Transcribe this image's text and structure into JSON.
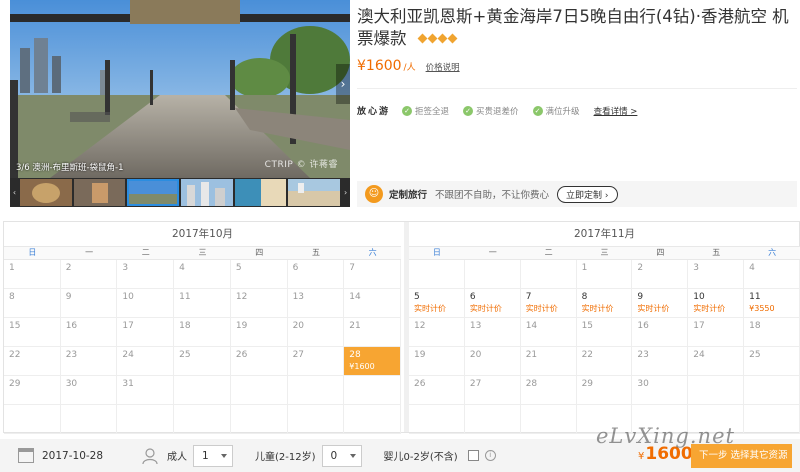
{
  "gallery": {
    "caption": "3/6 澳洲-布里斯班-袋鼠角-1",
    "photo_watermark": "CTRIP © 许蒋睿",
    "next_arrow": "›",
    "thumb_prev": "‹",
    "thumb_next": "›",
    "active_thumb": 3
  },
  "product": {
    "title": "澳大利亚凯恩斯+黄金海岸7日5晚自由行(4钻)·香港航空 机票爆款",
    "diamond_count": 4,
    "price": "¥1600",
    "per_person": "/人",
    "price_link": "价格说明"
  },
  "assurance": {
    "title": "放心游",
    "items": [
      "拒签全退",
      "买贵退差价",
      "满位升级"
    ],
    "more": "查看详情 >"
  },
  "custom": {
    "icon": "☺",
    "title": "定制旅行",
    "text": "不跟团不自助，不让你费心",
    "button": "立即定制 ›"
  },
  "calendar": {
    "weekdays": [
      "日",
      "一",
      "二",
      "三",
      "四",
      "五",
      "六"
    ],
    "months": [
      {
        "title": "2017年10月",
        "weeks": [
          [
            {
              "d": "1"
            },
            {
              "d": "2"
            },
            {
              "d": "3"
            },
            {
              "d": "4"
            },
            {
              "d": "5"
            },
            {
              "d": "6"
            },
            {
              "d": "7"
            }
          ],
          [
            {
              "d": "8"
            },
            {
              "d": "9"
            },
            {
              "d": "10"
            },
            {
              "d": "11"
            },
            {
              "d": "12"
            },
            {
              "d": "13"
            },
            {
              "d": "14"
            }
          ],
          [
            {
              "d": "15"
            },
            {
              "d": "16"
            },
            {
              "d": "17"
            },
            {
              "d": "18"
            },
            {
              "d": "19"
            },
            {
              "d": "20"
            },
            {
              "d": "21"
            }
          ],
          [
            {
              "d": "22"
            },
            {
              "d": "23"
            },
            {
              "d": "24"
            },
            {
              "d": "25"
            },
            {
              "d": "26"
            },
            {
              "d": "27"
            },
            {
              "d": "28",
              "info": "¥1600",
              "selected": true
            }
          ],
          [
            {
              "d": "29"
            },
            {
              "d": "30"
            },
            {
              "d": "31"
            },
            {
              "d": ""
            },
            {
              "d": ""
            },
            {
              "d": ""
            },
            {
              "d": ""
            }
          ],
          [
            {
              "d": ""
            },
            {
              "d": ""
            },
            {
              "d": ""
            },
            {
              "d": ""
            },
            {
              "d": ""
            },
            {
              "d": ""
            },
            {
              "d": ""
            }
          ]
        ]
      },
      {
        "title": "2017年11月",
        "weeks": [
          [
            {
              "d": ""
            },
            {
              "d": ""
            },
            {
              "d": ""
            },
            {
              "d": "1"
            },
            {
              "d": "2"
            },
            {
              "d": "3"
            },
            {
              "d": "4"
            }
          ],
          [
            {
              "d": "5",
              "info": "实时计价"
            },
            {
              "d": "6",
              "info": "实时计价"
            },
            {
              "d": "7",
              "info": "实时计价"
            },
            {
              "d": "8",
              "info": "实时计价"
            },
            {
              "d": "9",
              "info": "实时计价"
            },
            {
              "d": "10",
              "info": "实时计价"
            },
            {
              "d": "11",
              "info": "¥3550"
            }
          ],
          [
            {
              "d": "12"
            },
            {
              "d": "13"
            },
            {
              "d": "14"
            },
            {
              "d": "15"
            },
            {
              "d": "16"
            },
            {
              "d": "17"
            },
            {
              "d": "18"
            }
          ],
          [
            {
              "d": "19"
            },
            {
              "d": "20"
            },
            {
              "d": "21"
            },
            {
              "d": "22"
            },
            {
              "d": "23"
            },
            {
              "d": "24"
            },
            {
              "d": "25"
            }
          ],
          [
            {
              "d": "26"
            },
            {
              "d": "27"
            },
            {
              "d": "28"
            },
            {
              "d": "29"
            },
            {
              "d": "30"
            },
            {
              "d": ""
            },
            {
              "d": ""
            }
          ],
          [
            {
              "d": ""
            },
            {
              "d": ""
            },
            {
              "d": ""
            },
            {
              "d": ""
            },
            {
              "d": ""
            },
            {
              "d": ""
            },
            {
              "d": ""
            }
          ]
        ]
      }
    ]
  },
  "booking": {
    "date": "2017-10-28",
    "adult_label": "成人",
    "adult_value": "1",
    "child_label": "儿童(2-12岁)",
    "child_value": "0",
    "infant_label": "婴儿0-2岁(不含)",
    "info_symbol": "i",
    "total_currency": "¥",
    "total_amount": "1600",
    "book_button": "下一步 选择其它资源"
  },
  "site_watermark": "eLvXing.net",
  "colors": {
    "accent_orange": "#f06c00",
    "selected_day": "#f7a532",
    "weekend_blue": "#3a7fd6",
    "check_green": "#8bc76a"
  }
}
